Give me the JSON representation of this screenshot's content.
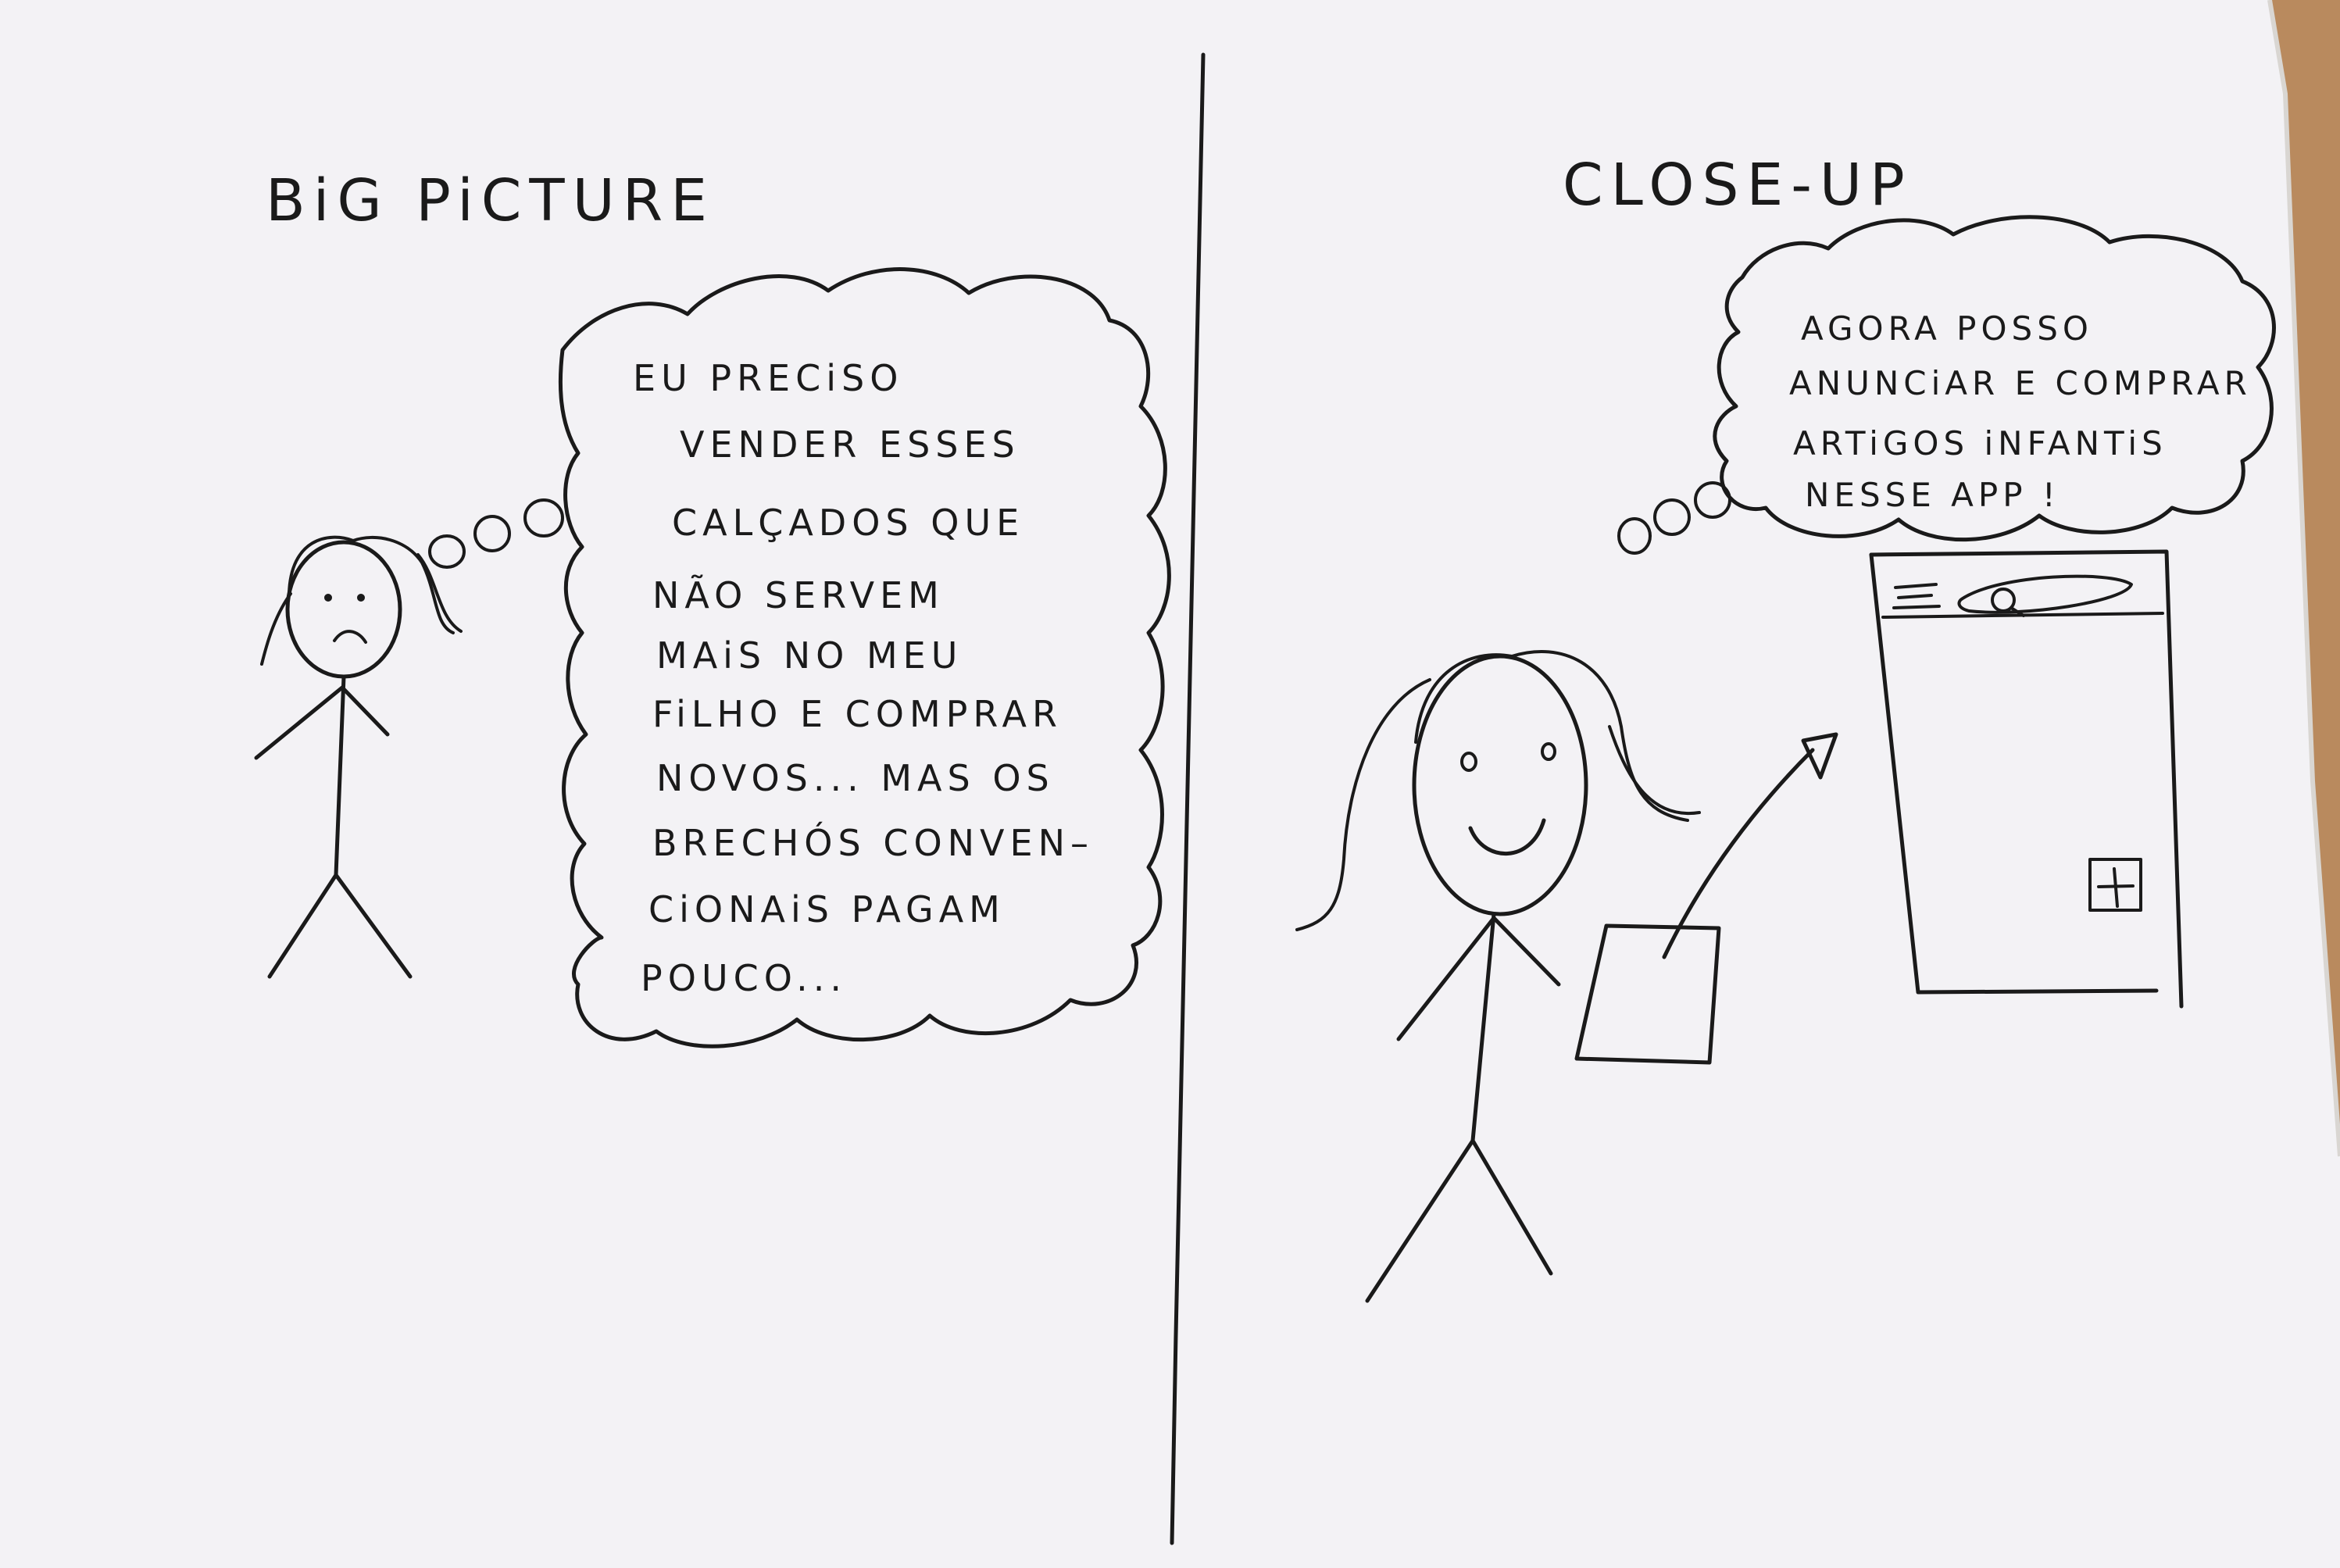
{
  "colors": {
    "paper": "#f4f3f6",
    "table": "#b98a5e",
    "ink": "#1a1a1a"
  },
  "left_panel": {
    "title": "BiG   PiCTURE",
    "thought_lines": [
      "EU  PRECiSO",
      "VENDER  ESSES",
      "CALÇADOS  QUE",
      "NÃO  SERVEM",
      "MAiS  NO  MEU",
      "FiLHO  E  COMPRAR",
      "NOVOS...  MAS  OS",
      "BRECHÓS  CONVEN–",
      "CiONAiS  PAGAM",
      "POUCO..."
    ]
  },
  "right_panel": {
    "title": "CLOSE-UP",
    "thought_lines": [
      "AGORA  POSSO",
      "ANUNCiAR  E  COMPRAR",
      "ARTiGOS  iNFANTiS",
      "NESSE  APP !"
    ],
    "app_sketch_icons": [
      "menu-icon",
      "search-icon",
      "add-icon"
    ]
  }
}
